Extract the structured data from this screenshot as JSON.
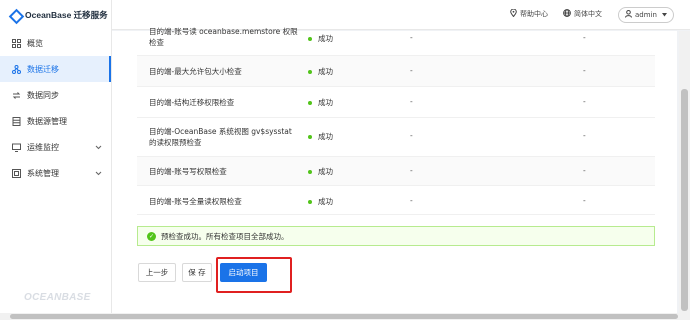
{
  "app": {
    "logo_text": "OceanBase 迁移服务",
    "watermark": "OCEANBASE"
  },
  "sidebar": {
    "items": [
      {
        "label": "概览",
        "icon": "grid-icon",
        "active": false
      },
      {
        "label": "数据迁移",
        "icon": "migrate-icon",
        "active": true
      },
      {
        "label": "数据同步",
        "icon": "sync-icon",
        "active": false
      },
      {
        "label": "数据源管理",
        "icon": "database-icon",
        "active": false
      },
      {
        "label": "运维监控",
        "icon": "monitor-icon",
        "active": false,
        "expandable": true
      },
      {
        "label": "系统管理",
        "icon": "system-icon",
        "active": false,
        "expandable": true
      }
    ]
  },
  "header": {
    "help": "帮助中心",
    "language": "简体中文",
    "user": "admin"
  },
  "checks": {
    "rows": [
      {
        "name_line1": "目的端-账号读 oceanbase.memstore 权限",
        "name_line2": "检查",
        "status": "成功",
        "detail1": "-",
        "detail2": "-"
      },
      {
        "name_line1": "目的端-最大允许包大小检查",
        "name_line2": "",
        "status": "成功",
        "detail1": "-",
        "detail2": "-"
      },
      {
        "name_line1": "目的端-结构迁移权限检查",
        "name_line2": "",
        "status": "成功",
        "detail1": "-",
        "detail2": "-"
      },
      {
        "name_line1": "目的端-OceanBase 系统视图 gv$sysstat",
        "name_line2": "的读权限预检查",
        "status": "成功",
        "detail1": "-",
        "detail2": "-"
      },
      {
        "name_line1": "目的端-账号写权限检查",
        "name_line2": "",
        "status": "成功",
        "detail1": "-",
        "detail2": "-"
      },
      {
        "name_line1": "目的端-账号全量读权限检查",
        "name_line2": "",
        "status": "成功",
        "detail1": "-",
        "detail2": "-"
      }
    ]
  },
  "alert": {
    "text": "预检查成功。所有检查项目全部成功。"
  },
  "actions": {
    "prev": "上一步",
    "save": "保 存",
    "start": "启动项目"
  },
  "colors": {
    "accent": "#1a73e8",
    "success": "#52c41a",
    "highlight": "#e02020"
  }
}
